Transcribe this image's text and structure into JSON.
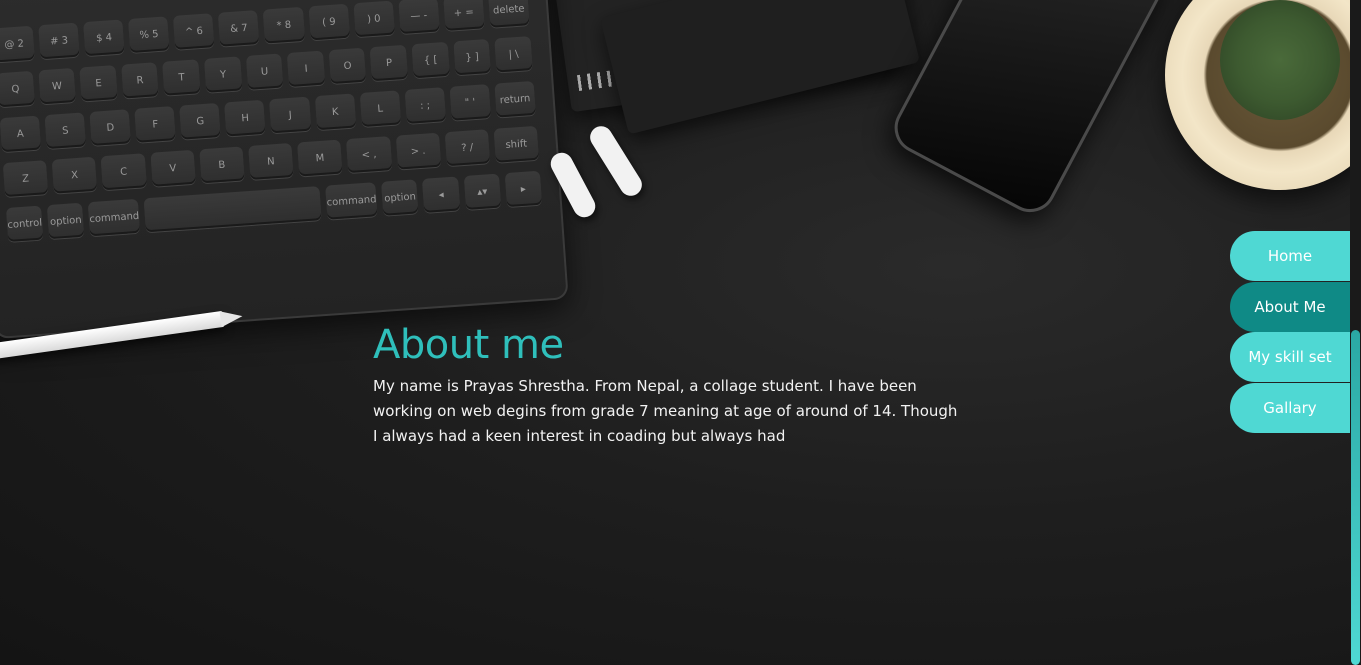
{
  "about": {
    "heading": "About me",
    "paragraph": "My name is Prayas Shrestha. From Nepal, a collage student. I have been working on web degins from grade 7 meaning at age of around of 14. Though I always had a keen interest in coading but always had"
  },
  "nav": {
    "items": [
      {
        "label": "Home",
        "active": false
      },
      {
        "label": "About Me",
        "active": true
      },
      {
        "label": "My skill set",
        "active": false
      },
      {
        "label": "Gallary",
        "active": false
      }
    ]
  },
  "keyboard": {
    "row1": [
      "@\n2",
      "#\n3",
      "$\n4",
      "%\n5",
      "^\n6",
      "&\n7",
      "*\n8",
      "(\n9",
      ")\n0",
      "—\n-",
      "+\n=",
      "delete"
    ],
    "row2": [
      "Q",
      "W",
      "E",
      "R",
      "T",
      "Y",
      "U",
      "I",
      "O",
      "P",
      "{\n[",
      "}\n]",
      "|\n\\"
    ],
    "row3": [
      "A",
      "S",
      "D",
      "F",
      "G",
      "H",
      "J",
      "K",
      "L",
      ":\n;",
      "\"\n'",
      "return"
    ],
    "row4": [
      "Z",
      "X",
      "C",
      "V",
      "B",
      "N",
      "M",
      "<\n,",
      ">\n.",
      "?\n/",
      "shift"
    ],
    "row5": [
      "control",
      "option",
      "command",
      "",
      "command",
      "option",
      "◂",
      "▴▾",
      "▸"
    ]
  },
  "colors": {
    "accent": "#2fbfbb",
    "nav_bg": "#4fd8d3",
    "nav_active": "#0f8a86"
  }
}
